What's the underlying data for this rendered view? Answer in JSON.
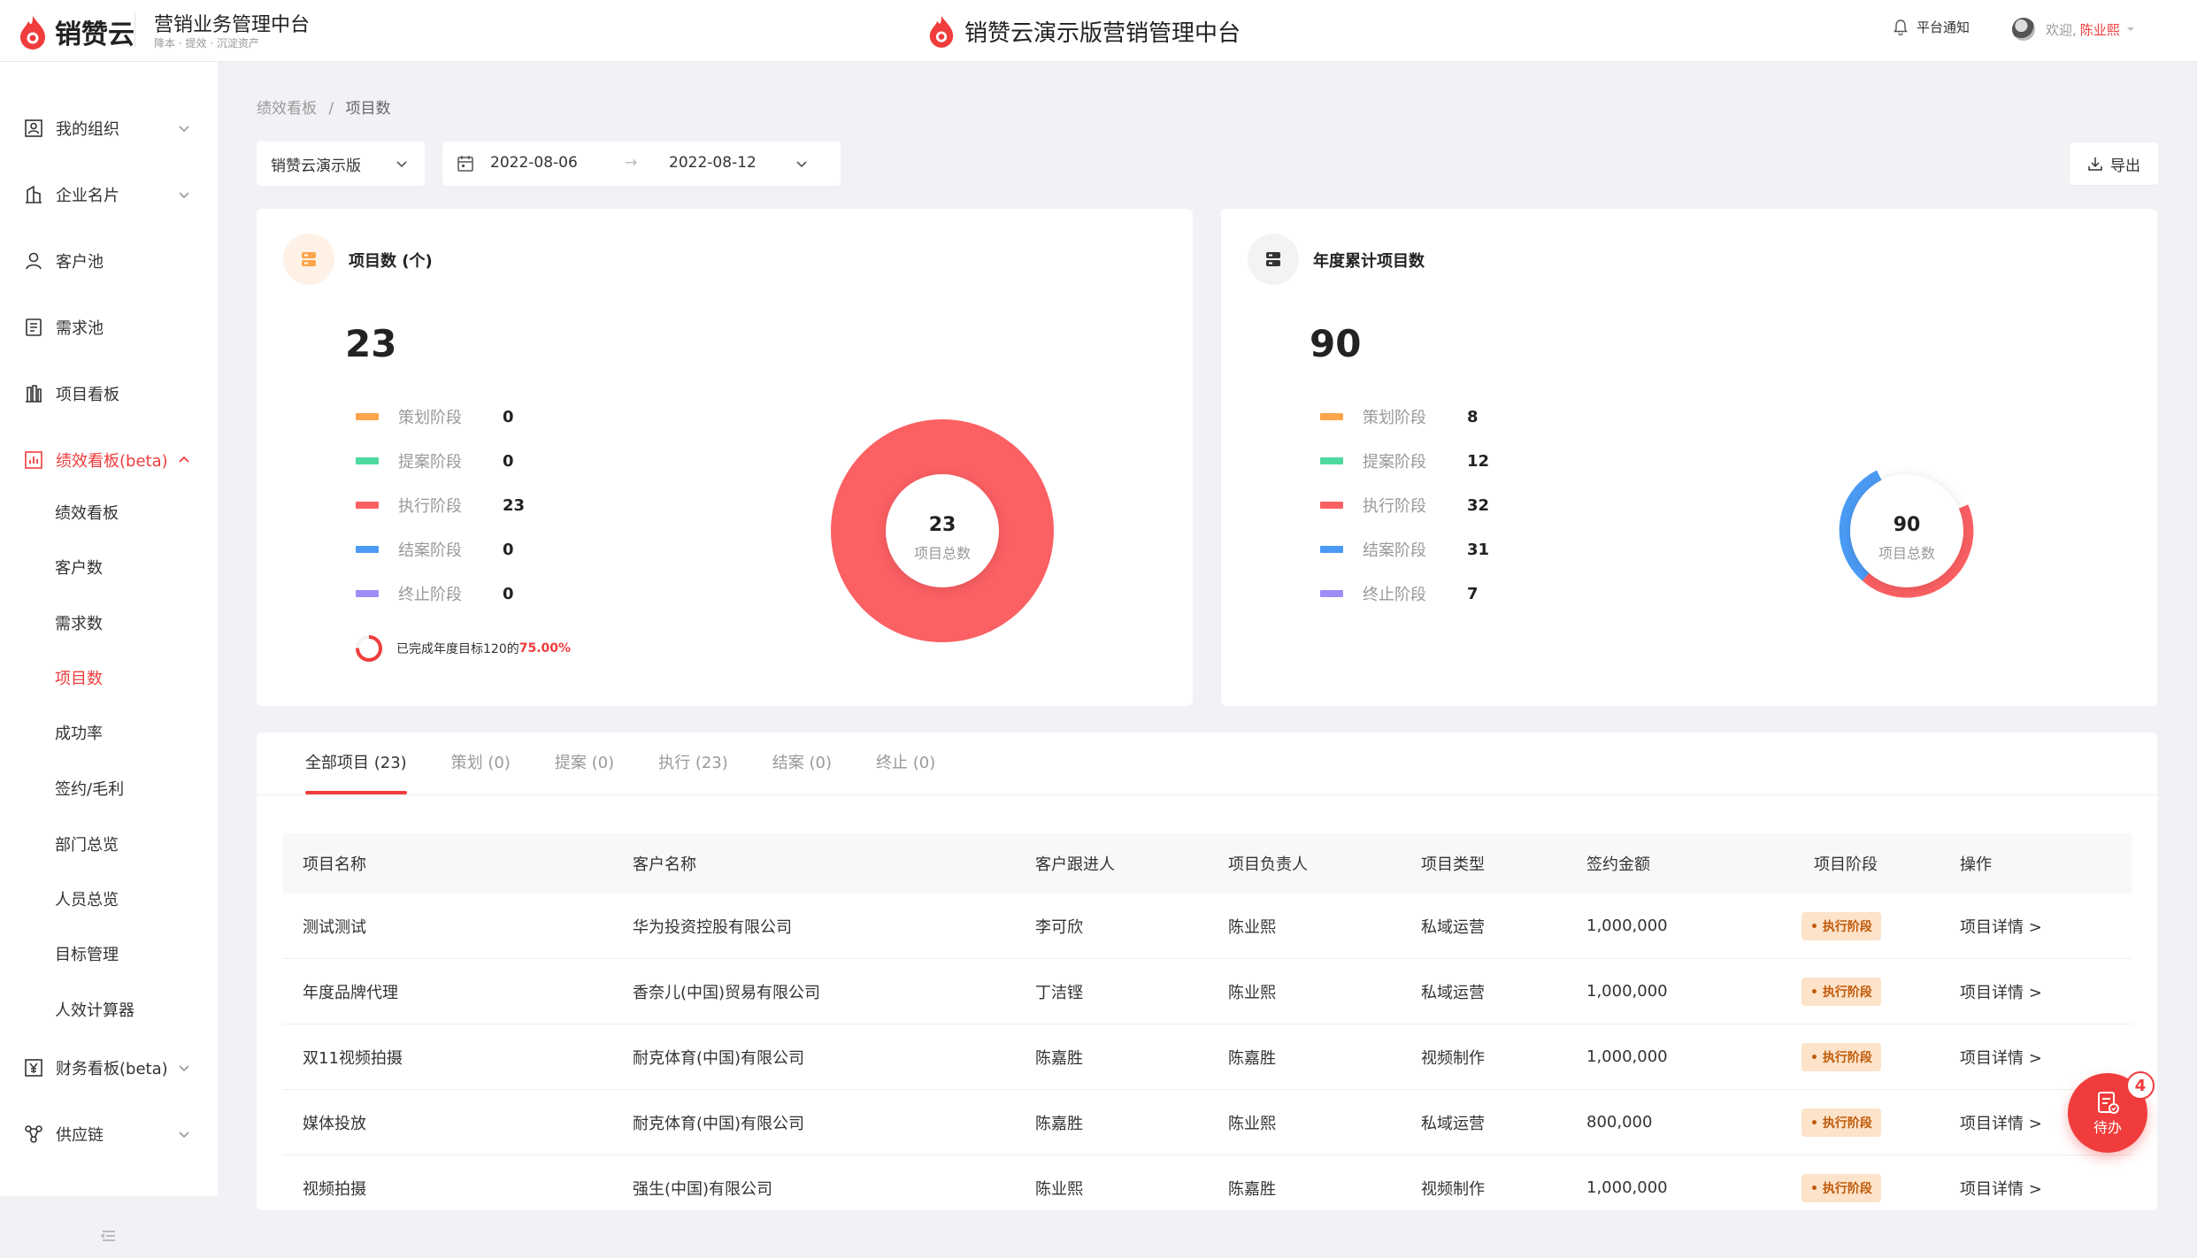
{
  "header": {
    "brand": "销赞云",
    "system_title": "营销业务管理中台",
    "system_subtitle": "降本 · 提效 · 沉淀资产",
    "center_title": "销赞云演示版营销管理中台",
    "notice_label": "平台通知",
    "welcome": "欢迎,",
    "user_name": "陈业熙"
  },
  "sidebar": {
    "items": [
      {
        "label": "我的组织",
        "icon": "org-icon"
      },
      {
        "label": "企业名片",
        "icon": "building-icon"
      },
      {
        "label": "客户池",
        "icon": "user-icon"
      },
      {
        "label": "需求池",
        "icon": "document-icon"
      },
      {
        "label": "项目看板",
        "icon": "board-icon"
      },
      {
        "label": "绩效看板(beta)",
        "icon": "chart-icon"
      },
      {
        "label": "财务看板(beta)",
        "icon": "yen-icon"
      },
      {
        "label": "供应链",
        "icon": "chain-icon"
      }
    ],
    "sub_items": [
      "绩效看板",
      "客户数",
      "需求数",
      "项目数",
      "成功率",
      "签约/毛利",
      "部门总览",
      "人员总览",
      "目标管理",
      "人效计算器"
    ]
  },
  "breadcrumb": {
    "parent": "绩效看板",
    "sep": "/",
    "current": "项目数"
  },
  "filters": {
    "org": "销赞云演示版",
    "date_start": "2022-08-06",
    "date_sep": "→",
    "date_end": "2022-08-12",
    "export_label": "导出"
  },
  "colors": {
    "planning": "#fda54b",
    "proposal": "#4fd9a0",
    "execution": "#fb6063",
    "closing": "#4b9bf5",
    "terminated": "#9d8ef5",
    "accent": "#f03c3c"
  },
  "left_card": {
    "title": "项目数 (个)",
    "total": "23",
    "center_value": "23",
    "center_label": "项目总数",
    "legend": [
      {
        "name": "策划阶段",
        "value": "0"
      },
      {
        "name": "提案阶段",
        "value": "0"
      },
      {
        "name": "执行阶段",
        "value": "23"
      },
      {
        "name": "结案阶段",
        "value": "0"
      },
      {
        "name": "终止阶段",
        "value": "0"
      }
    ],
    "goal_text": "已完成年度目标120的",
    "goal_pct": "75.00%"
  },
  "right_card": {
    "title": "年度累计项目数",
    "total": "90",
    "center_value": "90",
    "center_label": "项目总数",
    "legend": [
      {
        "name": "策划阶段",
        "value": "8"
      },
      {
        "name": "提案阶段",
        "value": "12"
      },
      {
        "name": "执行阶段",
        "value": "32"
      },
      {
        "name": "结案阶段",
        "value": "31"
      },
      {
        "name": "终止阶段",
        "value": "7"
      }
    ]
  },
  "tabs": [
    "全部项目 (23)",
    "策划 (0)",
    "提案 (0)",
    "执行 (23)",
    "结案 (0)",
    "终止 (0)"
  ],
  "table": {
    "columns": [
      "项目名称",
      "客户名称",
      "客户跟进人",
      "项目负责人",
      "项目类型",
      "签约金额",
      "项目阶段",
      "操作"
    ],
    "rows": [
      {
        "name": "测试测试",
        "client": "华为投资控股有限公司",
        "follower": "李可欣",
        "owner": "陈业熙",
        "type": "私域运营",
        "amount": "1,000,000",
        "stage": "• 执行阶段",
        "action": "项目详情 >"
      },
      {
        "name": "年度品牌代理",
        "client": "香奈儿(中国)贸易有限公司",
        "follower": "丁洁铿",
        "owner": "陈业熙",
        "type": "私域运营",
        "amount": "1,000,000",
        "stage": "• 执行阶段",
        "action": "项目详情 >"
      },
      {
        "name": "双11视频拍摄",
        "client": "耐克体育(中国)有限公司",
        "follower": "陈嘉胜",
        "owner": "陈嘉胜",
        "type": "视频制作",
        "amount": "1,000,000",
        "stage": "• 执行阶段",
        "action": "项目详情 >"
      },
      {
        "name": "媒体投放",
        "client": "耐克体育(中国)有限公司",
        "follower": "陈嘉胜",
        "owner": "陈业熙",
        "type": "私域运营",
        "amount": "800,000",
        "stage": "• 执行阶段",
        "action": "项目详情 >"
      },
      {
        "name": "视频拍摄",
        "client": "强生(中国)有限公司",
        "follower": "陈业熙",
        "owner": "陈嘉胜",
        "type": "视频制作",
        "amount": "1,000,000",
        "stage": "• 执行阶段",
        "action": "项目详情 >"
      }
    ]
  },
  "todo": {
    "label": "待办",
    "count": "4"
  }
}
